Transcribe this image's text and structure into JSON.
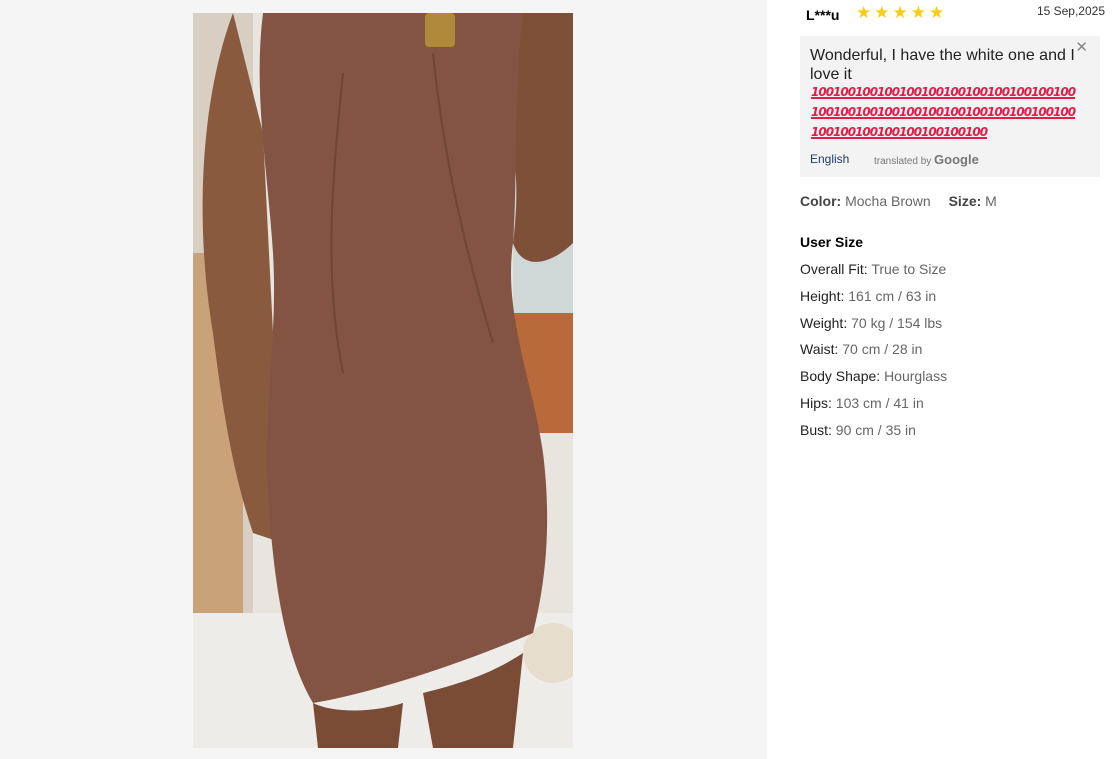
{
  "photo": {
    "description_icon": "review-photo"
  },
  "review": {
    "reviewer": "L***u",
    "rating": 5,
    "stars": [
      "★",
      "★",
      "★",
      "★",
      "★"
    ],
    "date": "15 Sep,2025",
    "text": "Wonderful, I have the white one and I love it",
    "emoji_count": 32,
    "emoji_glyph": "100",
    "language_link": "English",
    "translated_by": "translated by",
    "translated_by_brand": "Google"
  },
  "attributes": {
    "color_label": "Color:",
    "color_value": "Mocha Brown",
    "size_label": "Size:",
    "size_value": "M"
  },
  "user_size": {
    "title": "User Size",
    "items": [
      {
        "label": "Overall Fit:",
        "value": "True to Size"
      },
      {
        "label": "Height:",
        "value": "161 cm / 63 in"
      },
      {
        "label": "Weight:",
        "value": "70 kg / 154 lbs"
      },
      {
        "label": "Waist:",
        "value": "70 cm / 28 in"
      },
      {
        "label": "Body Shape:",
        "value": "Hourglass"
      },
      {
        "label": "Hips:",
        "value": "103 cm / 41 in"
      },
      {
        "label": "Bust:",
        "value": "90 cm / 35 in"
      }
    ]
  }
}
